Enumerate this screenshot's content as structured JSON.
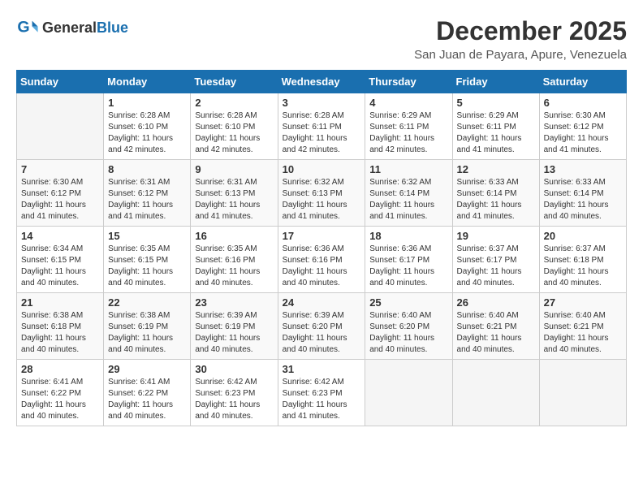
{
  "logo": {
    "general": "General",
    "blue": "Blue"
  },
  "header": {
    "month": "December 2025",
    "location": "San Juan de Payara, Apure, Venezuela"
  },
  "weekdays": [
    "Sunday",
    "Monday",
    "Tuesday",
    "Wednesday",
    "Thursday",
    "Friday",
    "Saturday"
  ],
  "weeks": [
    [
      {
        "day": "",
        "info": ""
      },
      {
        "day": "1",
        "info": "Sunrise: 6:28 AM\nSunset: 6:10 PM\nDaylight: 11 hours and 42 minutes."
      },
      {
        "day": "2",
        "info": "Sunrise: 6:28 AM\nSunset: 6:10 PM\nDaylight: 11 hours and 42 minutes."
      },
      {
        "day": "3",
        "info": "Sunrise: 6:28 AM\nSunset: 6:11 PM\nDaylight: 11 hours and 42 minutes."
      },
      {
        "day": "4",
        "info": "Sunrise: 6:29 AM\nSunset: 6:11 PM\nDaylight: 11 hours and 42 minutes."
      },
      {
        "day": "5",
        "info": "Sunrise: 6:29 AM\nSunset: 6:11 PM\nDaylight: 11 hours and 41 minutes."
      },
      {
        "day": "6",
        "info": "Sunrise: 6:30 AM\nSunset: 6:12 PM\nDaylight: 11 hours and 41 minutes."
      }
    ],
    [
      {
        "day": "7",
        "info": "Sunrise: 6:30 AM\nSunset: 6:12 PM\nDaylight: 11 hours and 41 minutes."
      },
      {
        "day": "8",
        "info": "Sunrise: 6:31 AM\nSunset: 6:12 PM\nDaylight: 11 hours and 41 minutes."
      },
      {
        "day": "9",
        "info": "Sunrise: 6:31 AM\nSunset: 6:13 PM\nDaylight: 11 hours and 41 minutes."
      },
      {
        "day": "10",
        "info": "Sunrise: 6:32 AM\nSunset: 6:13 PM\nDaylight: 11 hours and 41 minutes."
      },
      {
        "day": "11",
        "info": "Sunrise: 6:32 AM\nSunset: 6:14 PM\nDaylight: 11 hours and 41 minutes."
      },
      {
        "day": "12",
        "info": "Sunrise: 6:33 AM\nSunset: 6:14 PM\nDaylight: 11 hours and 41 minutes."
      },
      {
        "day": "13",
        "info": "Sunrise: 6:33 AM\nSunset: 6:14 PM\nDaylight: 11 hours and 40 minutes."
      }
    ],
    [
      {
        "day": "14",
        "info": "Sunrise: 6:34 AM\nSunset: 6:15 PM\nDaylight: 11 hours and 40 minutes."
      },
      {
        "day": "15",
        "info": "Sunrise: 6:35 AM\nSunset: 6:15 PM\nDaylight: 11 hours and 40 minutes."
      },
      {
        "day": "16",
        "info": "Sunrise: 6:35 AM\nSunset: 6:16 PM\nDaylight: 11 hours and 40 minutes."
      },
      {
        "day": "17",
        "info": "Sunrise: 6:36 AM\nSunset: 6:16 PM\nDaylight: 11 hours and 40 minutes."
      },
      {
        "day": "18",
        "info": "Sunrise: 6:36 AM\nSunset: 6:17 PM\nDaylight: 11 hours and 40 minutes."
      },
      {
        "day": "19",
        "info": "Sunrise: 6:37 AM\nSunset: 6:17 PM\nDaylight: 11 hours and 40 minutes."
      },
      {
        "day": "20",
        "info": "Sunrise: 6:37 AM\nSunset: 6:18 PM\nDaylight: 11 hours and 40 minutes."
      }
    ],
    [
      {
        "day": "21",
        "info": "Sunrise: 6:38 AM\nSunset: 6:18 PM\nDaylight: 11 hours and 40 minutes."
      },
      {
        "day": "22",
        "info": "Sunrise: 6:38 AM\nSunset: 6:19 PM\nDaylight: 11 hours and 40 minutes."
      },
      {
        "day": "23",
        "info": "Sunrise: 6:39 AM\nSunset: 6:19 PM\nDaylight: 11 hours and 40 minutes."
      },
      {
        "day": "24",
        "info": "Sunrise: 6:39 AM\nSunset: 6:20 PM\nDaylight: 11 hours and 40 minutes."
      },
      {
        "day": "25",
        "info": "Sunrise: 6:40 AM\nSunset: 6:20 PM\nDaylight: 11 hours and 40 minutes."
      },
      {
        "day": "26",
        "info": "Sunrise: 6:40 AM\nSunset: 6:21 PM\nDaylight: 11 hours and 40 minutes."
      },
      {
        "day": "27",
        "info": "Sunrise: 6:40 AM\nSunset: 6:21 PM\nDaylight: 11 hours and 40 minutes."
      }
    ],
    [
      {
        "day": "28",
        "info": "Sunrise: 6:41 AM\nSunset: 6:22 PM\nDaylight: 11 hours and 40 minutes."
      },
      {
        "day": "29",
        "info": "Sunrise: 6:41 AM\nSunset: 6:22 PM\nDaylight: 11 hours and 40 minutes."
      },
      {
        "day": "30",
        "info": "Sunrise: 6:42 AM\nSunset: 6:23 PM\nDaylight: 11 hours and 40 minutes."
      },
      {
        "day": "31",
        "info": "Sunrise: 6:42 AM\nSunset: 6:23 PM\nDaylight: 11 hours and 41 minutes."
      },
      {
        "day": "",
        "info": ""
      },
      {
        "day": "",
        "info": ""
      },
      {
        "day": "",
        "info": ""
      }
    ]
  ]
}
